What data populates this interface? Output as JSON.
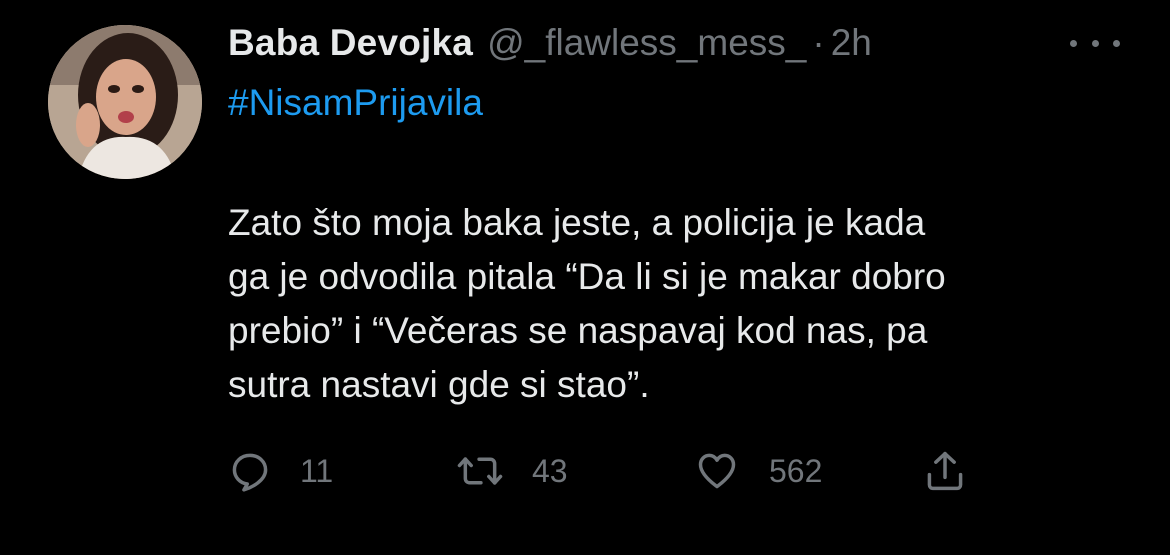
{
  "author": {
    "display_name": "Baba Devojka",
    "handle": "@_flawless_mess_",
    "separator": "·",
    "time": "2h"
  },
  "tweet": {
    "hashtag": "#NisamPrijavila",
    "lines": [
      "Zato što moja baka jeste, a policija je kada",
      "ga je odvodila pitala “Da li si je makar dobro",
      "prebio” i “Večeras se naspavaj kod nas, pa",
      "sutra nastavi gde si stao”."
    ]
  },
  "actions": {
    "replies": "11",
    "retweets": "43",
    "likes": "562"
  },
  "icons": {
    "more": "more-horizontal-icon",
    "reply": "reply-icon",
    "retweet": "retweet-icon",
    "like": "heart-icon",
    "share": "share-icon"
  },
  "colors": {
    "background": "#000000",
    "text": "#e7e9ea",
    "secondary": "#71767b",
    "link": "#1d9bf0"
  }
}
